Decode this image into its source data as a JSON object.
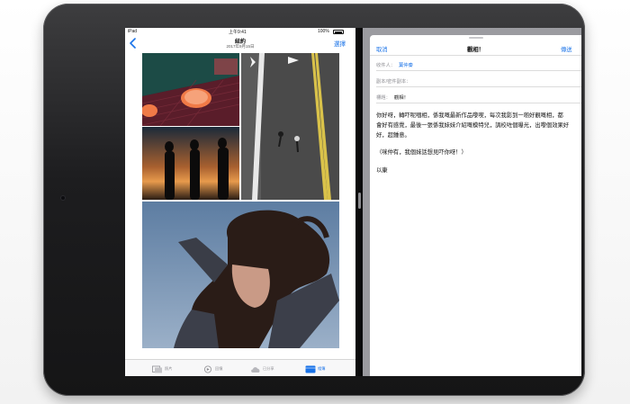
{
  "left_app": {
    "status": {
      "carrier": "iPad",
      "time": "上午9:41",
      "battery": "100%"
    },
    "nav": {
      "title": "紐約",
      "subtitle": "2017年9月15日",
      "edit": "選擇"
    },
    "tabs": [
      {
        "label": "照片",
        "icon": "photos-icon"
      },
      {
        "label": "回憶",
        "icon": "memories-icon"
      },
      {
        "label": "已分享",
        "icon": "shared-cloud-icon"
      },
      {
        "label": "相簿",
        "icon": "albums-icon",
        "active": true
      }
    ]
  },
  "mail": {
    "cancel": "取消",
    "title": "觀相！",
    "send": "傳送",
    "to_label": "收件人：",
    "to_value": "葉仲秦",
    "cc_label": "副本/密件副本：",
    "subject_label": "標題：",
    "subject_value": "觀相！",
    "body": {
      "line1": "你好呀，轉吓呢嗰相，係我嘅最新作品嚟喫，每次我影到一啲好靚嘅相，都",
      "line2": "會好有感覺，最後一張係我妹妹介紹嘅模特兒，調校咗個曝光，出嚟個效果好",
      "line3": "好，超鍾意。",
      "line4": "（咪仲有，我個妹話想見吓你呀！）",
      "signoff": "以康"
    }
  },
  "colors": {
    "accent": "#1a73e8",
    "bezel": "#1d1d1f"
  }
}
